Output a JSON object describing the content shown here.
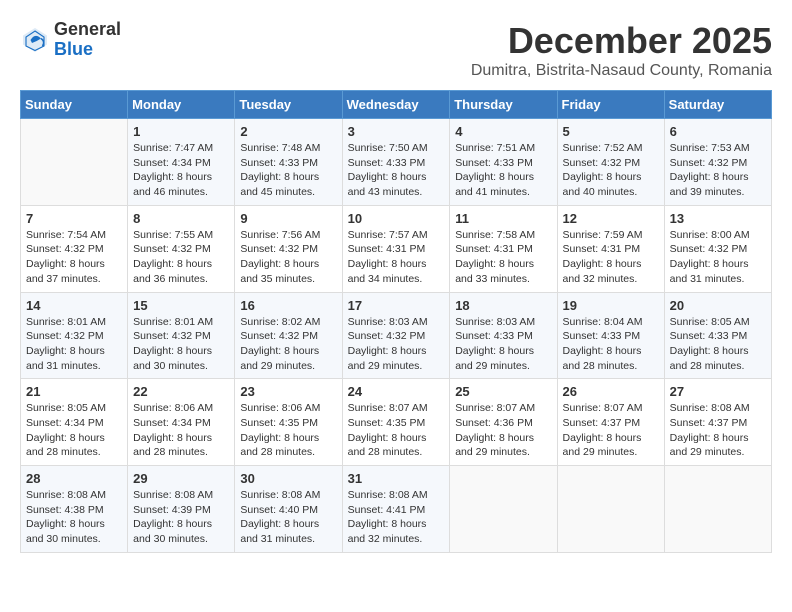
{
  "header": {
    "logo_general": "General",
    "logo_blue": "Blue",
    "month_title": "December 2025",
    "location": "Dumitra, Bistrita-Nasaud County, Romania"
  },
  "days_of_week": [
    "Sunday",
    "Monday",
    "Tuesday",
    "Wednesday",
    "Thursday",
    "Friday",
    "Saturday"
  ],
  "weeks": [
    [
      {
        "day": "",
        "info": ""
      },
      {
        "day": "1",
        "info": "Sunrise: 7:47 AM\nSunset: 4:34 PM\nDaylight: 8 hours\nand 46 minutes."
      },
      {
        "day": "2",
        "info": "Sunrise: 7:48 AM\nSunset: 4:33 PM\nDaylight: 8 hours\nand 45 minutes."
      },
      {
        "day": "3",
        "info": "Sunrise: 7:50 AM\nSunset: 4:33 PM\nDaylight: 8 hours\nand 43 minutes."
      },
      {
        "day": "4",
        "info": "Sunrise: 7:51 AM\nSunset: 4:33 PM\nDaylight: 8 hours\nand 41 minutes."
      },
      {
        "day": "5",
        "info": "Sunrise: 7:52 AM\nSunset: 4:32 PM\nDaylight: 8 hours\nand 40 minutes."
      },
      {
        "day": "6",
        "info": "Sunrise: 7:53 AM\nSunset: 4:32 PM\nDaylight: 8 hours\nand 39 minutes."
      }
    ],
    [
      {
        "day": "7",
        "info": "Sunrise: 7:54 AM\nSunset: 4:32 PM\nDaylight: 8 hours\nand 37 minutes."
      },
      {
        "day": "8",
        "info": "Sunrise: 7:55 AM\nSunset: 4:32 PM\nDaylight: 8 hours\nand 36 minutes."
      },
      {
        "day": "9",
        "info": "Sunrise: 7:56 AM\nSunset: 4:32 PM\nDaylight: 8 hours\nand 35 minutes."
      },
      {
        "day": "10",
        "info": "Sunrise: 7:57 AM\nSunset: 4:31 PM\nDaylight: 8 hours\nand 34 minutes."
      },
      {
        "day": "11",
        "info": "Sunrise: 7:58 AM\nSunset: 4:31 PM\nDaylight: 8 hours\nand 33 minutes."
      },
      {
        "day": "12",
        "info": "Sunrise: 7:59 AM\nSunset: 4:31 PM\nDaylight: 8 hours\nand 32 minutes."
      },
      {
        "day": "13",
        "info": "Sunrise: 8:00 AM\nSunset: 4:32 PM\nDaylight: 8 hours\nand 31 minutes."
      }
    ],
    [
      {
        "day": "14",
        "info": "Sunrise: 8:01 AM\nSunset: 4:32 PM\nDaylight: 8 hours\nand 31 minutes."
      },
      {
        "day": "15",
        "info": "Sunrise: 8:01 AM\nSunset: 4:32 PM\nDaylight: 8 hours\nand 30 minutes."
      },
      {
        "day": "16",
        "info": "Sunrise: 8:02 AM\nSunset: 4:32 PM\nDaylight: 8 hours\nand 29 minutes."
      },
      {
        "day": "17",
        "info": "Sunrise: 8:03 AM\nSunset: 4:32 PM\nDaylight: 8 hours\nand 29 minutes."
      },
      {
        "day": "18",
        "info": "Sunrise: 8:03 AM\nSunset: 4:33 PM\nDaylight: 8 hours\nand 29 minutes."
      },
      {
        "day": "19",
        "info": "Sunrise: 8:04 AM\nSunset: 4:33 PM\nDaylight: 8 hours\nand 28 minutes."
      },
      {
        "day": "20",
        "info": "Sunrise: 8:05 AM\nSunset: 4:33 PM\nDaylight: 8 hours\nand 28 minutes."
      }
    ],
    [
      {
        "day": "21",
        "info": "Sunrise: 8:05 AM\nSunset: 4:34 PM\nDaylight: 8 hours\nand 28 minutes."
      },
      {
        "day": "22",
        "info": "Sunrise: 8:06 AM\nSunset: 4:34 PM\nDaylight: 8 hours\nand 28 minutes."
      },
      {
        "day": "23",
        "info": "Sunrise: 8:06 AM\nSunset: 4:35 PM\nDaylight: 8 hours\nand 28 minutes."
      },
      {
        "day": "24",
        "info": "Sunrise: 8:07 AM\nSunset: 4:35 PM\nDaylight: 8 hours\nand 28 minutes."
      },
      {
        "day": "25",
        "info": "Sunrise: 8:07 AM\nSunset: 4:36 PM\nDaylight: 8 hours\nand 29 minutes."
      },
      {
        "day": "26",
        "info": "Sunrise: 8:07 AM\nSunset: 4:37 PM\nDaylight: 8 hours\nand 29 minutes."
      },
      {
        "day": "27",
        "info": "Sunrise: 8:08 AM\nSunset: 4:37 PM\nDaylight: 8 hours\nand 29 minutes."
      }
    ],
    [
      {
        "day": "28",
        "info": "Sunrise: 8:08 AM\nSunset: 4:38 PM\nDaylight: 8 hours\nand 30 minutes."
      },
      {
        "day": "29",
        "info": "Sunrise: 8:08 AM\nSunset: 4:39 PM\nDaylight: 8 hours\nand 30 minutes."
      },
      {
        "day": "30",
        "info": "Sunrise: 8:08 AM\nSunset: 4:40 PM\nDaylight: 8 hours\nand 31 minutes."
      },
      {
        "day": "31",
        "info": "Sunrise: 8:08 AM\nSunset: 4:41 PM\nDaylight: 8 hours\nand 32 minutes."
      },
      {
        "day": "",
        "info": ""
      },
      {
        "day": "",
        "info": ""
      },
      {
        "day": "",
        "info": ""
      }
    ]
  ]
}
